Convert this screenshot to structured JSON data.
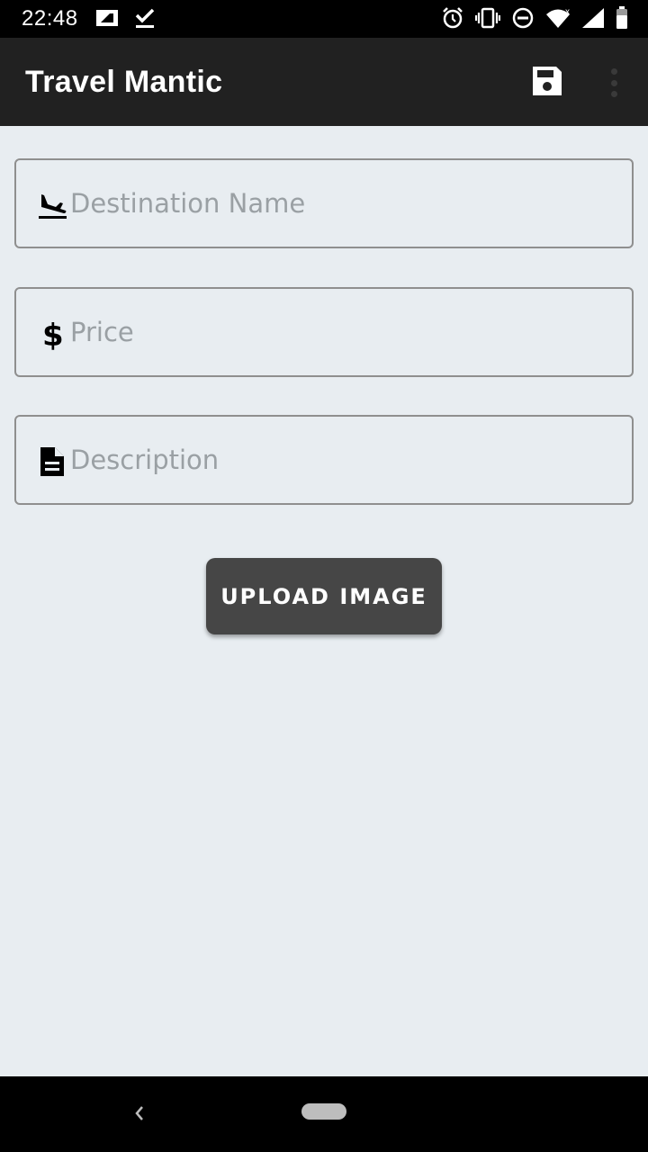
{
  "status_bar": {
    "time": "22:48",
    "left_icons": [
      "sim-card-icon",
      "check-download-icon"
    ],
    "right_icons": [
      "alarm-icon",
      "vibrate-icon",
      "do-not-disturb-icon",
      "wifi-icon",
      "signal-icon",
      "battery-icon"
    ]
  },
  "app_bar": {
    "title": "Travel Mantic",
    "actions": [
      "save-icon",
      "overflow-menu-icon"
    ]
  },
  "form": {
    "destination": {
      "placeholder": "Destination Name",
      "icon": "flight-land-icon",
      "value": ""
    },
    "price": {
      "placeholder": "Price",
      "icon": "dollar-icon",
      "value": ""
    },
    "description": {
      "placeholder": "Description",
      "icon": "document-icon",
      "value": ""
    },
    "upload_label": "UPLOAD IMAGE"
  },
  "nav_bar": {
    "items": [
      "back-icon",
      "home-pill"
    ]
  },
  "colors": {
    "app_bar": "#212121",
    "background": "#e8edf1",
    "button": "#464646",
    "field_border": "#8f8f8f"
  }
}
